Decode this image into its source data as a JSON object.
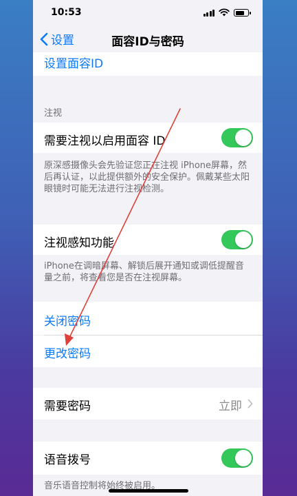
{
  "status_bar": {
    "time": "10:53"
  },
  "nav": {
    "back_label": "设置",
    "title": "面容ID与密码"
  },
  "rows": {
    "setup_face_id": "设置面容ID",
    "attention_header": "注视",
    "require_attention": "需要注视以启用面容 ID",
    "require_attention_footer": "原深感摄像头会先验证您正在注视 iPhone屏幕，然后再认证，以此提供额外的安全保护。佩戴某些太阳眼镜时可能无法进行注视检测。",
    "attention_aware": "注视感知功能",
    "attention_aware_footer": "iPhone在调暗屏幕、解锁后展开通知或调低提醒音量之前，将查看您是否在注视屏幕。",
    "turn_off_passcode": "关闭密码",
    "change_passcode": "更改密码",
    "require_passcode": "需要密码",
    "require_passcode_value": "立即",
    "voice_dial": "语音拨号",
    "voice_dial_footer": "音乐语音控制将始终被启用。"
  },
  "toggles": {
    "require_attention": true,
    "attention_aware": true,
    "voice_dial": true
  },
  "colors": {
    "accent": "#0a7aff",
    "toggle_on": "#34c759",
    "annotation_arrow": "#e0403a"
  },
  "icons": [
    "back-chevron-icon",
    "chevron-right-icon",
    "wifi-icon",
    "battery-icon",
    "signal-icon"
  ]
}
